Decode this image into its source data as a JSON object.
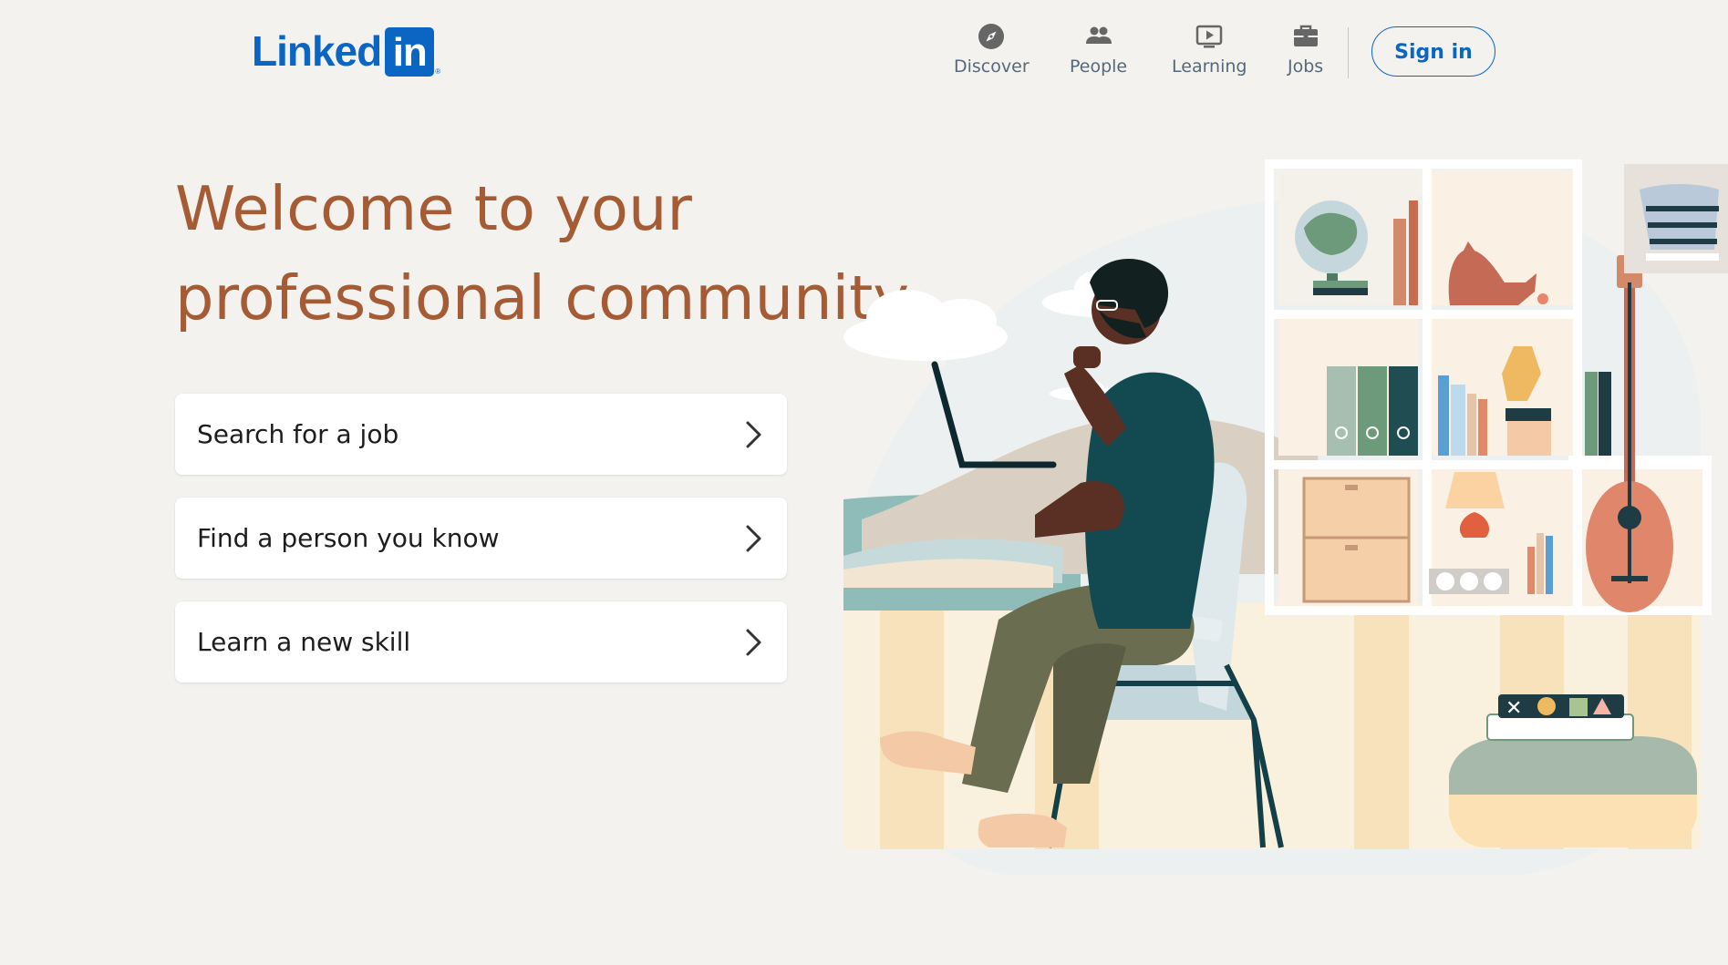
{
  "header": {
    "logo_word": "Linked",
    "logo_box": "in",
    "logo_reg": "®",
    "nav": [
      {
        "label": "Discover",
        "icon": "compass-icon"
      },
      {
        "label": "People",
        "icon": "people-icon"
      },
      {
        "label": "Learning",
        "icon": "play-screen-icon"
      },
      {
        "label": "Jobs",
        "icon": "briefcase-icon"
      }
    ],
    "signin_label": "Sign in"
  },
  "hero": {
    "title_line1": "Welcome to your",
    "title_line2": "professional community"
  },
  "actions": [
    {
      "label": "Search for a job"
    },
    {
      "label": "Find a person you know"
    },
    {
      "label": "Learn a new skill"
    }
  ],
  "colors": {
    "brand_blue": "#0a66c2",
    "headline_brown": "#a55c35",
    "page_background": "#f3f2ef",
    "nav_gray": "#56687a"
  }
}
